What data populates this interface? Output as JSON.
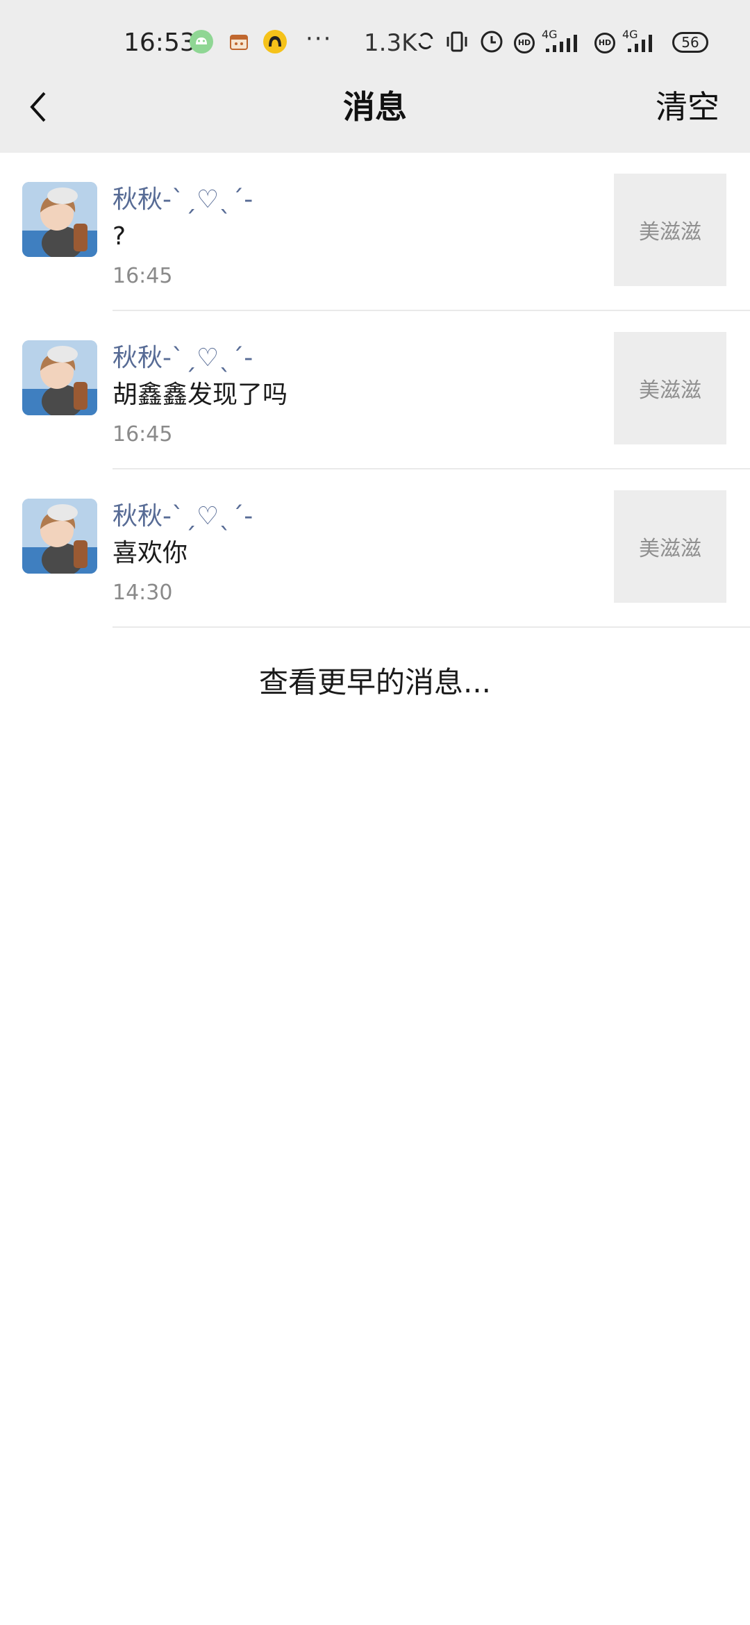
{
  "status_bar": {
    "time": "16:53",
    "net_speed": "1.3K",
    "more": "···",
    "signal_1_type": "4G",
    "signal_2_type": "4G",
    "battery": "56",
    "icons": [
      "android-app-icon",
      "box-app-icon",
      "yellow-app-icon",
      "sync-icon",
      "vibrate-icon",
      "alarm-icon",
      "hd-icon",
      "signal-icon",
      "hd-icon",
      "signal-icon",
      "battery-icon"
    ]
  },
  "nav": {
    "back_icon": "chevron-left-icon",
    "title": "消息",
    "clear_label": "清空"
  },
  "messages": [
    {
      "name": "秋秋-ˋˏ♡ˎˊ-",
      "text": "?",
      "time": "16:45",
      "thumb": "美滋滋"
    },
    {
      "name": "秋秋-ˋˏ♡ˎˊ-",
      "text": "胡鑫鑫发现了吗",
      "time": "16:45",
      "thumb": "美滋滋"
    },
    {
      "name": "秋秋-ˋˏ♡ˎˊ-",
      "text": "喜欢你",
      "time": "14:30",
      "thumb": "美滋滋"
    }
  ],
  "view_earlier_label": "查看更早的消息...",
  "colors": {
    "header_bg": "#ededed",
    "name_color": "#576b95",
    "time_color": "#8a8a8a",
    "thumb_bg": "#ededed"
  }
}
